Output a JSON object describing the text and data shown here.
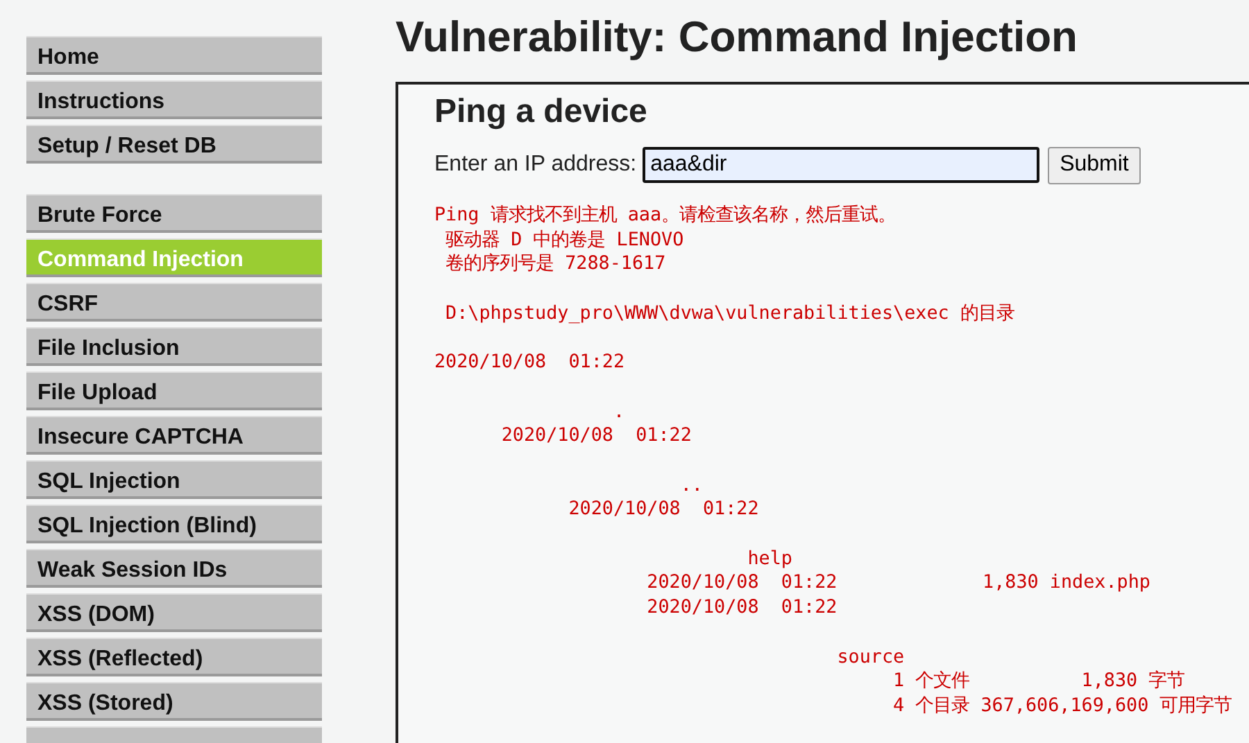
{
  "menu_groups": [
    [
      {
        "label": "Home",
        "selected": false
      },
      {
        "label": "Instructions",
        "selected": false
      },
      {
        "label": "Setup / Reset DB",
        "selected": false
      }
    ],
    [
      {
        "label": "Brute Force",
        "selected": false
      },
      {
        "label": "Command Injection",
        "selected": true
      },
      {
        "label": "CSRF",
        "selected": false
      },
      {
        "label": "File Inclusion",
        "selected": false
      },
      {
        "label": "File Upload",
        "selected": false
      },
      {
        "label": "Insecure CAPTCHA",
        "selected": false
      },
      {
        "label": "SQL Injection",
        "selected": false
      },
      {
        "label": "SQL Injection (Blind)",
        "selected": false
      },
      {
        "label": "Weak Session IDs",
        "selected": false
      },
      {
        "label": "XSS (DOM)",
        "selected": false
      },
      {
        "label": "XSS (Reflected)",
        "selected": false
      },
      {
        "label": "XSS (Stored)",
        "selected": false
      },
      {
        "selected": false
      }
    ]
  ],
  "page_title": "Vulnerability: Command Injection",
  "panel": {
    "heading": "Ping a device",
    "field_label": "Enter an IP address:",
    "field_value": "aaa&dir",
    "submit": "Submit",
    "output_blocks": [
      [
        "Ping 请求找不到主机 aaa。请检查该名称，然后重试。",
        " 驱动器 D 中的卷是 LENOVO",
        " 卷的序列号是 7288-1617"
      ],
      [
        " D:\\phpstudy_pro\\WWW\\dvwa\\vulnerabilities\\exec 的目录"
      ],
      [
        "2020/10/08  01:22"
      ],
      [
        "                .",
        "      2020/10/08  01:22"
      ],
      [
        "                      ..",
        "            2020/10/08  01:22"
      ],
      [
        "                            help",
        "                   2020/10/08  01:22             1,830 index.php",
        "                   2020/10/08  01:22"
      ],
      [
        "                                    source",
        "                                         1 个文件          1,830 字节",
        "                                         4 个目录 367,606,169,600 可用字节"
      ]
    ]
  }
}
